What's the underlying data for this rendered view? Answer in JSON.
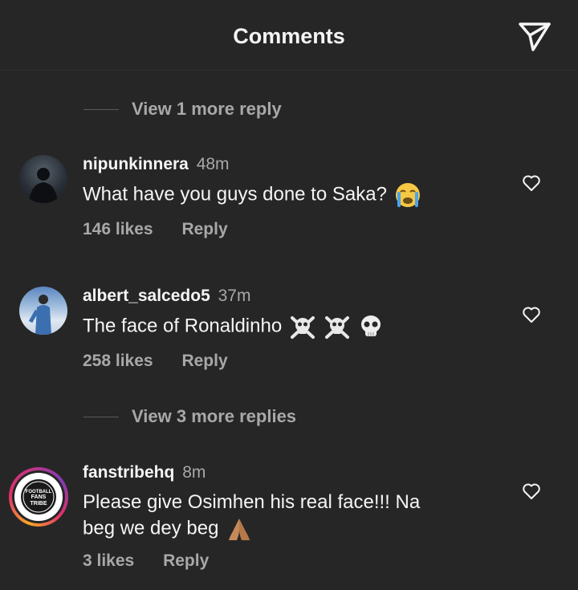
{
  "header": {
    "title": "Comments",
    "share_icon": "send-icon"
  },
  "view_more_1": "View 1 more reply",
  "view_more_2": "View 3 more replies",
  "comments": [
    {
      "username": "nipunkinnera",
      "time": "48m",
      "text": "What have you guys done to Saka?",
      "emoji": "crying-face",
      "likes": "146 likes",
      "reply": "Reply"
    },
    {
      "username": "albert_salcedo5",
      "time": "37m",
      "text": "The face of Ronaldinho",
      "emoji": "skull-crossbones x2, skull",
      "likes": "258 likes",
      "reply": "Reply"
    },
    {
      "username": "fanstribehq",
      "time": "8m",
      "text_line1": "Please give Osimhen his real face!!! Na",
      "text_line2": "beg we dey beg",
      "emoji": "folded-hands",
      "likes": "3 likes",
      "reply": "Reply",
      "avatar_logo": "FOOTBALL FANS TRIBE"
    }
  ],
  "colors": {
    "background": "#262626",
    "text": "#f5f5f5",
    "secondary": "#a8a8a8"
  }
}
